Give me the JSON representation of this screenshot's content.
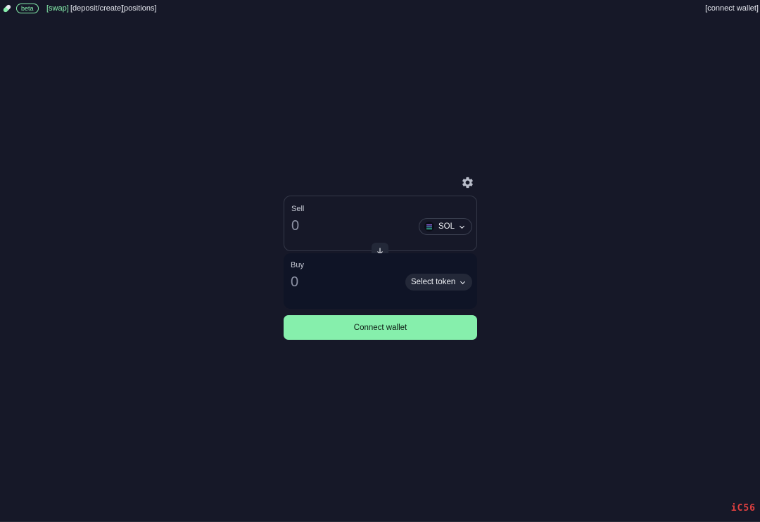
{
  "header": {
    "beta_badge": "beta",
    "nav": {
      "swap": "[swap]",
      "deposit_create": "[deposit/create]",
      "positions": "[positions]"
    },
    "connect_wallet": "[connect wallet]"
  },
  "swap": {
    "sell": {
      "label": "Sell",
      "amount_placeholder": "0",
      "token": "SOL"
    },
    "buy": {
      "label": "Buy",
      "amount_placeholder": "0",
      "token": "Select token"
    },
    "connect_button": "Connect wallet"
  },
  "watermark": "iC56",
  "colors": {
    "background": "#161828",
    "accent": "#86efac",
    "card_buy": "#0f1426",
    "button_bg": "#232838"
  },
  "icons": {
    "logo": "pill-logo-icon",
    "settings": "gear-icon",
    "swap_direction": "arrow-down-icon",
    "dropdown": "chevron-down-icon",
    "sol": "solana-icon"
  }
}
